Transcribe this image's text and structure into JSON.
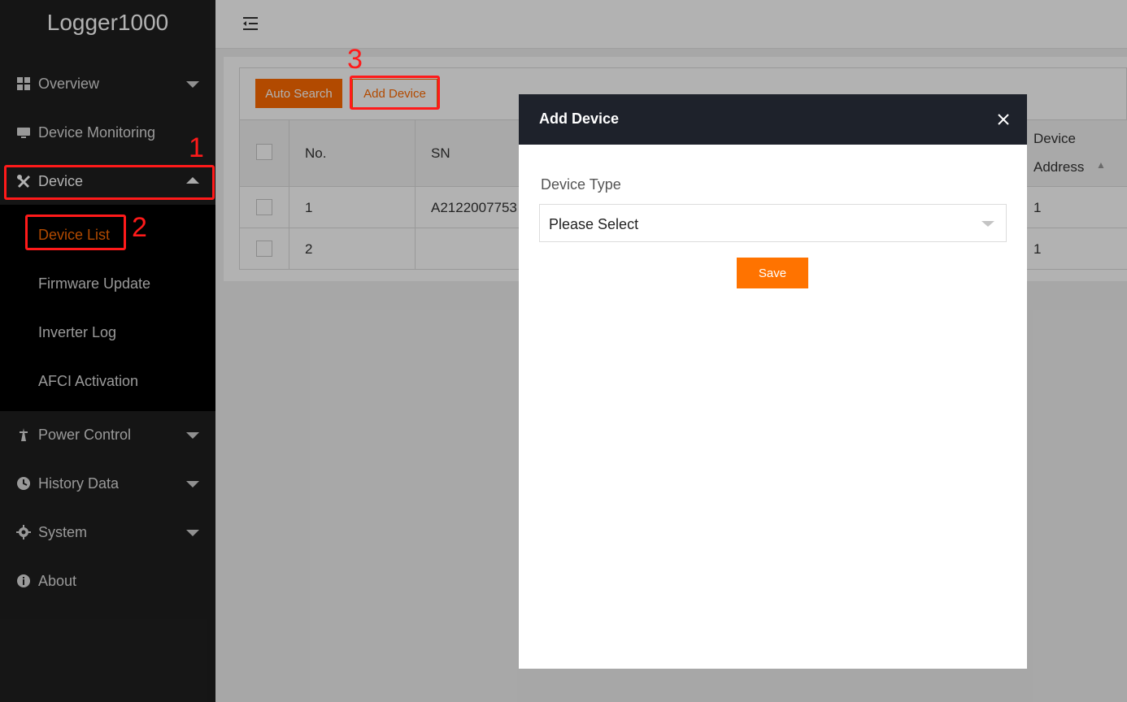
{
  "app": {
    "title": "Logger1000"
  },
  "sidebar": {
    "items": [
      {
        "label": "Overview",
        "icon": "grid-icon"
      },
      {
        "label": "Device Monitoring",
        "icon": "monitor-icon"
      },
      {
        "label": "Device",
        "icon": "tools-icon",
        "expanded": true
      },
      {
        "label": "Power Control",
        "icon": "power-tower-icon"
      },
      {
        "label": "History Data",
        "icon": "clock-icon"
      },
      {
        "label": "System",
        "icon": "gear-icon"
      },
      {
        "label": "About",
        "icon": "info-icon"
      }
    ],
    "device_submenu": [
      {
        "label": "Device List",
        "active": true
      },
      {
        "label": "Firmware Update"
      },
      {
        "label": "Inverter Log"
      },
      {
        "label": "AFCI Activation"
      }
    ]
  },
  "toolbar": {
    "auto_search": "Auto Search",
    "add_device": "Add Device"
  },
  "table": {
    "headers": {
      "no": "No.",
      "sn": "SN",
      "device_address_line1": "Device",
      "device_address_line2": "Address"
    },
    "rows": [
      {
        "no": "1",
        "sn": "A2122007753",
        "address": "1"
      },
      {
        "no": "2",
        "sn": "",
        "address": "1"
      }
    ]
  },
  "modal": {
    "title": "Add Device",
    "field_label": "Device Type",
    "select_value": "Please Select",
    "save_label": "Save"
  },
  "annotations": [
    "1",
    "2",
    "3"
  ],
  "colors": {
    "accent": "#ff6a00",
    "sidebar": "#1f1f1f",
    "annotation": "#ff1a1a",
    "modal_header": "#1e222b"
  }
}
